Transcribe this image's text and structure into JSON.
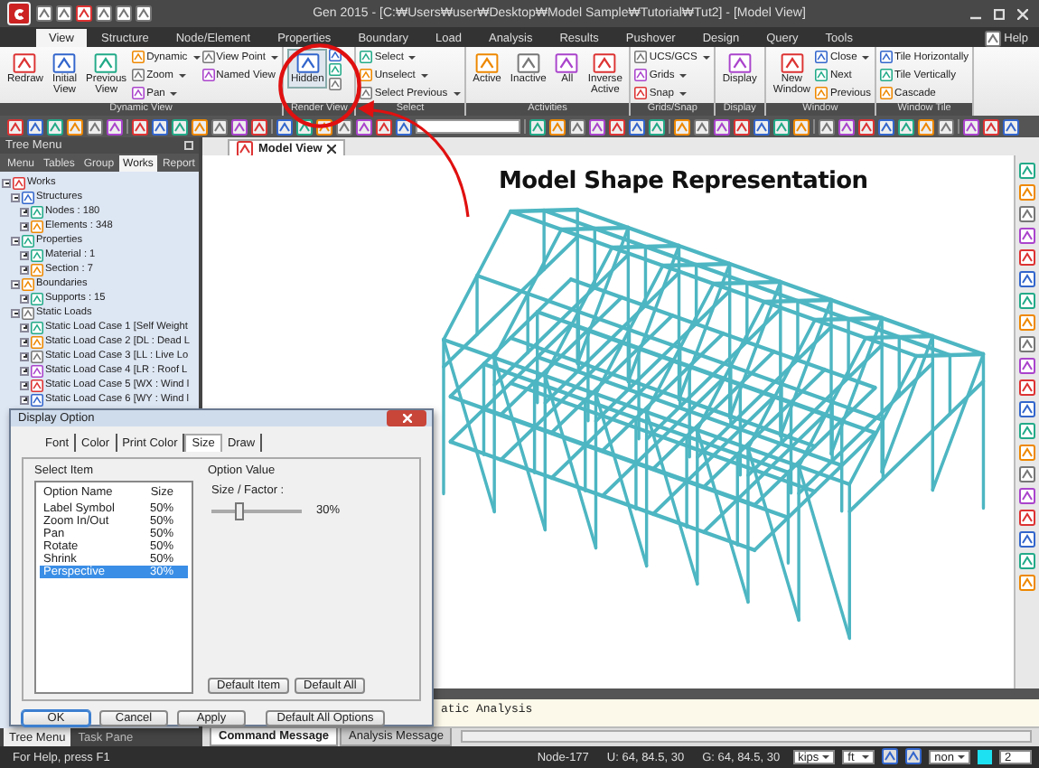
{
  "window": {
    "title": "Gen 2015 - [C:₩Users₩user₩Desktop₩Model Sample₩Tutorial₩Tut2] - [Model View]"
  },
  "menu_tabs": [
    {
      "label": "View",
      "selected": true
    },
    {
      "label": "Structure",
      "selected": false
    },
    {
      "label": "Node/Element",
      "selected": false
    },
    {
      "label": "Properties",
      "selected": false
    },
    {
      "label": "Boundary",
      "selected": false
    },
    {
      "label": "Load",
      "selected": false
    },
    {
      "label": "Analysis",
      "selected": false
    },
    {
      "label": "Results",
      "selected": false
    },
    {
      "label": "Pushover",
      "selected": false
    },
    {
      "label": "Design",
      "selected": false
    },
    {
      "label": "Query",
      "selected": false
    },
    {
      "label": "Tools",
      "selected": false
    }
  ],
  "help": "Help",
  "ribbon": {
    "groups": [
      {
        "label": "Dynamic View",
        "items": [
          {
            "kind": "large",
            "label": "Redraw"
          },
          {
            "kind": "large",
            "label": "Initial View"
          },
          {
            "kind": "large",
            "label": "Previous View"
          },
          {
            "kind": "stack",
            "buttons": [
              {
                "label": "Dynamic",
                "dropdown": true
              },
              {
                "label": "Zoom",
                "dropdown": true
              },
              {
                "label": "Pan",
                "dropdown": true
              }
            ]
          },
          {
            "kind": "stack",
            "buttons": [
              {
                "label": "View Point",
                "dropdown": true
              },
              {
                "label": "Named View",
                "dropdown": false
              }
            ]
          }
        ]
      },
      {
        "label": "Render View",
        "items": [
          {
            "kind": "large",
            "label": "Hidden",
            "pressed": true
          },
          {
            "kind": "icons"
          }
        ]
      },
      {
        "label": "Select",
        "items": [
          {
            "kind": "stack",
            "buttons": [
              {
                "label": "Select",
                "dropdown": true
              },
              {
                "label": "Unselect",
                "dropdown": true
              },
              {
                "label": "Select Previous",
                "dropdown": true
              }
            ]
          }
        ]
      },
      {
        "label": "Activities",
        "items": [
          {
            "kind": "large",
            "label": "Active"
          },
          {
            "kind": "large",
            "label": "Inactive"
          },
          {
            "kind": "large",
            "label": "All"
          },
          {
            "kind": "large",
            "label": "Inverse Active"
          }
        ]
      },
      {
        "label": "Grids/Snap",
        "items": [
          {
            "kind": "stack",
            "buttons": [
              {
                "label": "UCS/GCS",
                "dropdown": true
              },
              {
                "label": "Grids",
                "dropdown": true
              },
              {
                "label": "Snap",
                "dropdown": true
              }
            ]
          }
        ]
      },
      {
        "label": "Display",
        "items": [
          {
            "kind": "large",
            "label": "Display"
          }
        ]
      },
      {
        "label": "Window",
        "items": [
          {
            "kind": "large",
            "label": "New Window"
          },
          {
            "kind": "stack",
            "buttons": [
              {
                "label": "Close",
                "dropdown": true
              },
              {
                "label": "Next",
                "dropdown": false
              },
              {
                "label": "Previous",
                "dropdown": false
              }
            ]
          }
        ]
      },
      {
        "label": "Window Tile",
        "items": [
          {
            "kind": "stack",
            "buttons": [
              {
                "label": "Tile Horizontally",
                "dropdown": false
              },
              {
                "label": "Tile Vertically",
                "dropdown": false
              },
              {
                "label": "Cascade",
                "dropdown": false
              }
            ]
          }
        ]
      }
    ]
  },
  "tree_panel": {
    "title": "Tree Menu",
    "tabs": [
      {
        "label": "Menu",
        "selected": false
      },
      {
        "label": "Tables",
        "selected": false
      },
      {
        "label": "Group",
        "selected": false
      },
      {
        "label": "Works",
        "selected": true
      },
      {
        "label": "Report",
        "selected": false
      }
    ],
    "items": [
      {
        "label": "Works",
        "expanded": true,
        "children": [
          {
            "label": "Structures",
            "expanded": true,
            "children": [
              {
                "label": "Nodes : 180",
                "expanded": false
              },
              {
                "label": "Elements : 348",
                "expanded": false
              }
            ]
          },
          {
            "label": "Properties",
            "expanded": true,
            "children": [
              {
                "label": "Material : 1",
                "expanded": false
              },
              {
                "label": "Section : 7",
                "expanded": false
              }
            ]
          },
          {
            "label": "Boundaries",
            "expanded": true,
            "children": [
              {
                "label": "Supports : 15",
                "expanded": false
              }
            ]
          },
          {
            "label": "Static Loads",
            "expanded": true,
            "children": [
              {
                "label": "Static Load Case 1 [Self Weight",
                "expanded": false
              },
              {
                "label": "Static Load Case 2 [DL : Dead L",
                "expanded": false
              },
              {
                "label": "Static Load Case 3 [LL : Live Lo",
                "expanded": false
              },
              {
                "label": "Static Load Case 4 [LR : Roof L",
                "expanded": false
              },
              {
                "label": "Static Load Case 5 [WX : Wind l",
                "expanded": false
              },
              {
                "label": "Static Load Case 6 [WY : Wind l",
                "expanded": false
              }
            ]
          }
        ]
      }
    ],
    "bottom_tabs": [
      {
        "label": "Tree Menu",
        "selected": true
      },
      {
        "label": "Task Pane",
        "selected": false
      }
    ]
  },
  "view_tab": {
    "label": "Model View"
  },
  "annotation": {
    "label": "Model Shape Representation"
  },
  "message_panel": {
    "text": "atic Analysis",
    "tabs": [
      {
        "label": "Command Message",
        "selected": true
      },
      {
        "label": "Analysis Message",
        "selected": false
      }
    ]
  },
  "dialog": {
    "title": "Display Option",
    "tabs": [
      {
        "label": "Font",
        "selected": false
      },
      {
        "label": "Color",
        "selected": false
      },
      {
        "label": "Print Color",
        "selected": false
      },
      {
        "label": "Size",
        "selected": true
      },
      {
        "label": "Draw",
        "selected": false
      }
    ],
    "select_group": "Select Item",
    "columns": [
      "Option Name",
      "Size"
    ],
    "rows": [
      {
        "name": "Label Symbol",
        "size": "50%",
        "selected": false
      },
      {
        "name": "Zoom In/Out",
        "size": "50%",
        "selected": false
      },
      {
        "name": "Pan",
        "size": "50%",
        "selected": false
      },
      {
        "name": "Rotate",
        "size": "50%",
        "selected": false
      },
      {
        "name": "Shrink",
        "size": "50%",
        "selected": false
      },
      {
        "name": "Perspective",
        "size": "30%",
        "selected": true
      }
    ],
    "value_group": "Option Value",
    "factor_label": "Size / Factor :",
    "slider": {
      "level": 0.3
    },
    "reading": "30%",
    "group_buttons": [
      "Default Item",
      "Default All"
    ],
    "buttons": [
      {
        "label": "OK",
        "focused": true
      },
      {
        "label": "Cancel",
        "focused": false
      },
      {
        "label": "Apply",
        "focused": false
      },
      {
        "label": "Default All Options",
        "focused": false
      }
    ]
  },
  "status_bar": {
    "help": "For Help, press F1",
    "node": "Node-177",
    "ucs": "U: 64, 84.5, 30",
    "gcs": "G: 64, 84.5, 30",
    "unit_force": "kips",
    "unit_length": "ft",
    "filter": "non",
    "page": "2"
  }
}
